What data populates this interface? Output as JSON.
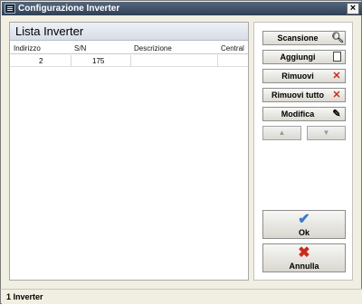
{
  "window": {
    "title": "Configurazione Inverter"
  },
  "list": {
    "title": "Lista Inverter",
    "columns": [
      "Indirizzo",
      "S/N",
      "Descrizione",
      "Central"
    ],
    "rows": [
      {
        "indirizzo": "2",
        "sn": "175",
        "descrizione": "",
        "central": ""
      }
    ]
  },
  "buttons": {
    "scansione": "Scansione",
    "aggiungi": "Aggiungi",
    "rimuovi": "Rimuovi",
    "rimuovi_tutto": "Rimuovi tutto",
    "modifica": "Modifica",
    "ok": "Ok",
    "annulla": "Annulla"
  },
  "icons": {
    "scansione": "search-icon",
    "aggiungi": "document-icon",
    "rimuovi": "close-icon",
    "rimuovi_tutto": "close-icon",
    "modifica": "edit-icon",
    "up": "arrow-up-icon",
    "down": "arrow-down-icon",
    "ok": "checkmark-icon",
    "annulla": "cancel-icon"
  },
  "status": {
    "text": "1 Inverter"
  },
  "colors": {
    "titlebar": "#3e4f66",
    "danger": "#cc2a1e",
    "ok": "#3a78c9"
  }
}
